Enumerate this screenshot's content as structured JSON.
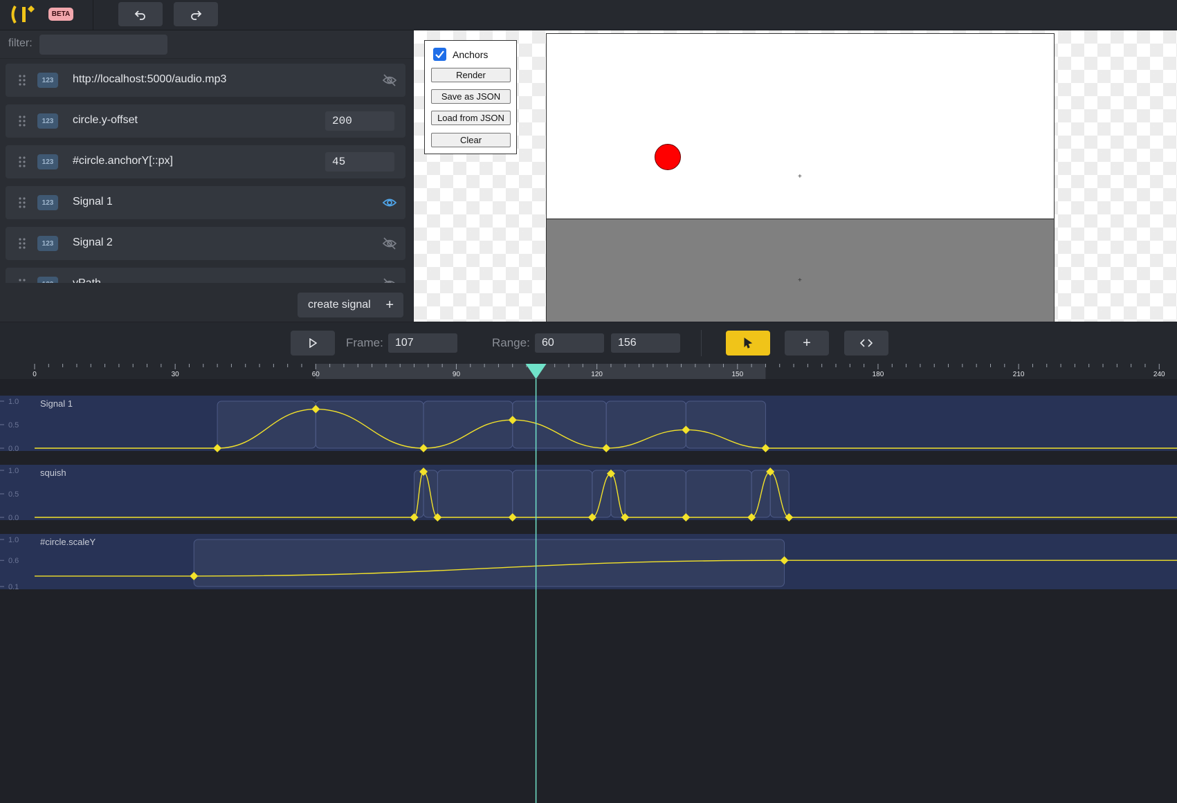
{
  "app": {
    "beta_label": "BETA",
    "logo_icon": "theatre-logo-icon",
    "undo_icon": "undo-icon",
    "redo_icon": "redo-icon"
  },
  "filter": {
    "label": "filter:",
    "value": ""
  },
  "signals": [
    {
      "name": "http://localhost:5000/audio.mp3",
      "badge": "123",
      "value": "",
      "visible": false
    },
    {
      "name": "circle.y-offset",
      "badge": "123",
      "value": "200"
    },
    {
      "name": "#circle.anchorY[::px]",
      "badge": "123",
      "value": "45"
    },
    {
      "name": "Signal 1",
      "badge": "123",
      "value": "",
      "visible": true
    },
    {
      "name": "Signal 2",
      "badge": "123",
      "value": "",
      "visible": false
    },
    {
      "name": "yPath",
      "badge": "123",
      "value": "",
      "visible": false
    }
  ],
  "create_signal": {
    "label": "create signal",
    "icon": "plus-icon"
  },
  "preview": {
    "anchors_label": "Anchors",
    "anchors_checked": true,
    "buttons": [
      "Render",
      "Save as JSON",
      "Load from JSON",
      "Clear"
    ],
    "colors": {
      "ball": "#ff0000",
      "ground": "#808080",
      "stage": "#ffffff"
    }
  },
  "transport": {
    "frame_label": "Frame:",
    "frame_value": "107",
    "range_label": "Range:",
    "range_start": "60",
    "range_end": "156",
    "tools": [
      "select-pointer-icon",
      "add-plus-icon",
      "code-brackets-icon"
    ]
  },
  "timeline": {
    "ruler_labels": [
      "0",
      "30",
      "60",
      "90",
      "120",
      "150",
      "180",
      "210",
      "240"
    ],
    "playhead_frame": 107,
    "accent_color": "#70e2c9",
    "curve_color": "#f3e22a",
    "tracks": [
      {
        "name": "Signal 1",
        "y_ticks": [
          "1.0",
          "0.5",
          "0.0"
        ],
        "range": [
          0,
          1
        ],
        "keyframes": [
          [
            39,
            0
          ],
          [
            60,
            0.83
          ],
          [
            83,
            0
          ],
          [
            102,
            0.6
          ],
          [
            122,
            0
          ],
          [
            139,
            0.39
          ],
          [
            156,
            0
          ]
        ]
      },
      {
        "name": "squish",
        "y_ticks": [
          "1.0",
          "0.5",
          "0.0"
        ],
        "range": [
          0,
          1
        ],
        "keyframes": [
          [
            81,
            0
          ],
          [
            83,
            0.97
          ],
          [
            86,
            0
          ],
          [
            102,
            0
          ],
          [
            119,
            0
          ],
          [
            123,
            0.93
          ],
          [
            126,
            0
          ],
          [
            139,
            0
          ],
          [
            153,
            0
          ],
          [
            157,
            0.97
          ],
          [
            161,
            0
          ]
        ]
      },
      {
        "name": "#circle.scaleY",
        "y_ticks": [
          "1.0",
          "0.6",
          "0.1"
        ],
        "range": [
          0.1,
          1
        ],
        "keyframes": [
          [
            34,
            0.3
          ],
          [
            160,
            0.6
          ]
        ]
      }
    ]
  }
}
